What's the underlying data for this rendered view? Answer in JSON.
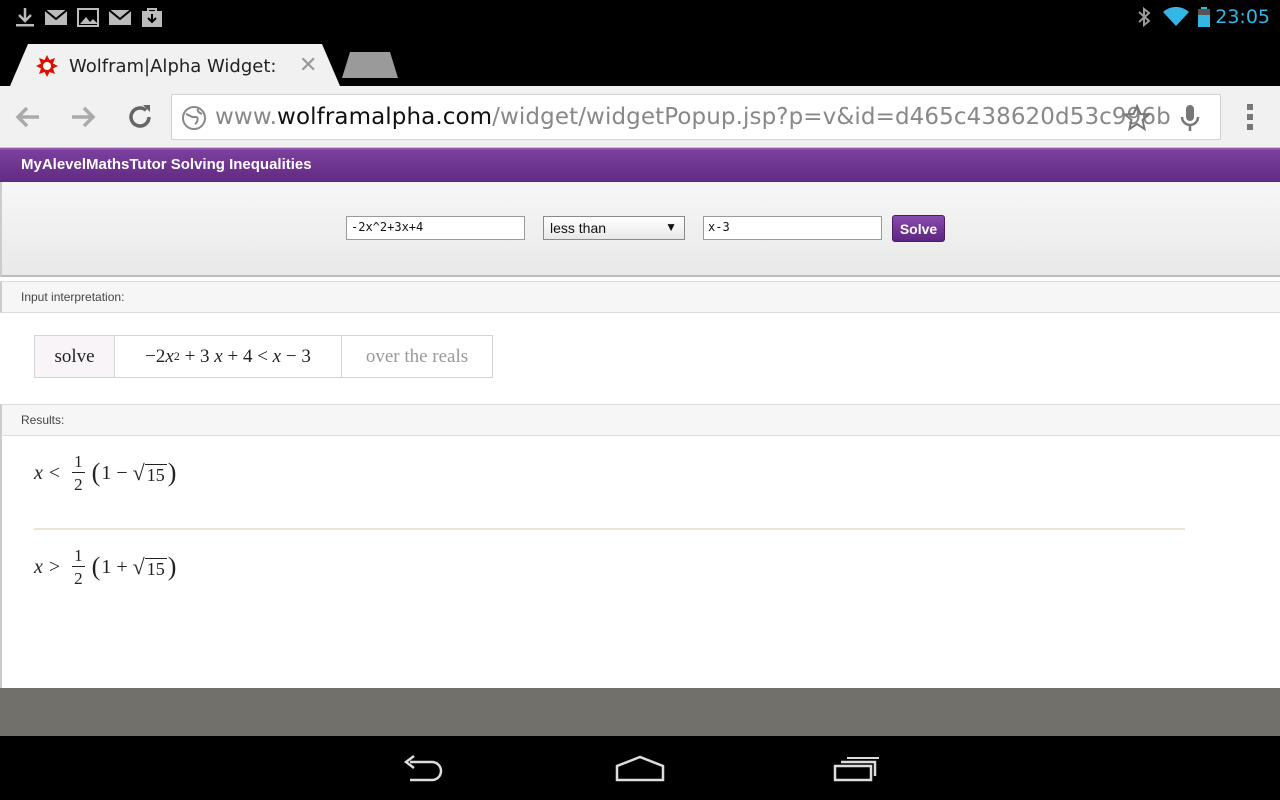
{
  "status_bar": {
    "time": "23:05",
    "left_icons": [
      "download-icon",
      "gmail-icon",
      "gallery-icon",
      "gmail-icon",
      "store-download-icon"
    ],
    "right_icons": [
      "bluetooth-icon",
      "wifi-icon",
      "battery-icon"
    ]
  },
  "browser": {
    "tab_title": "Wolfram|Alpha Widget:",
    "url_prefix": "www.",
    "url_domain": "wolframalpha.com",
    "url_path": "/widget/widgetPopup.jsp?p=v&id=d465c438620d53c996b"
  },
  "widget": {
    "title": "MyAlevelMathsTutor Solving Inequalities",
    "left_input": "-2x^2+3x+4",
    "relation": "less than",
    "right_input": "x-3",
    "solve_label": "Solve"
  },
  "input_interpretation": {
    "label": "Input interpretation:",
    "verb": "solve",
    "expr_a": "−2 ",
    "var1": "x",
    "exp": "2",
    "expr_b": " + 3 ",
    "var2": "x",
    "expr_c": " + 4 < ",
    "var3": "x",
    "expr_d": " − 3",
    "domain": "over the reals"
  },
  "results": {
    "label": "Results:",
    "items": [
      {
        "var": "x",
        "op": "<",
        "num": "1",
        "den": "2",
        "inner_a": "1 − ",
        "radicand": "15"
      },
      {
        "var": "x",
        "op": ">",
        "num": "1",
        "den": "2",
        "inner_a": "1 + ",
        "radicand": "15"
      }
    ]
  }
}
